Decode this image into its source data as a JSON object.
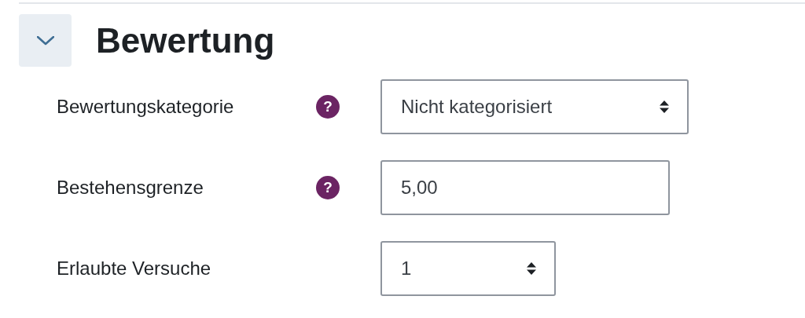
{
  "section": {
    "title": "Bewertung",
    "expanded": true
  },
  "fields": [
    {
      "label": "Bewertungskategorie",
      "help": "?",
      "kind": "select",
      "value": "Nicht kategorisiert"
    },
    {
      "label": "Bestehensgrenze",
      "help": "?",
      "kind": "text",
      "value": "5,00"
    },
    {
      "label": "Erlaubte Versuche",
      "kind": "select",
      "value": "1"
    }
  ]
}
